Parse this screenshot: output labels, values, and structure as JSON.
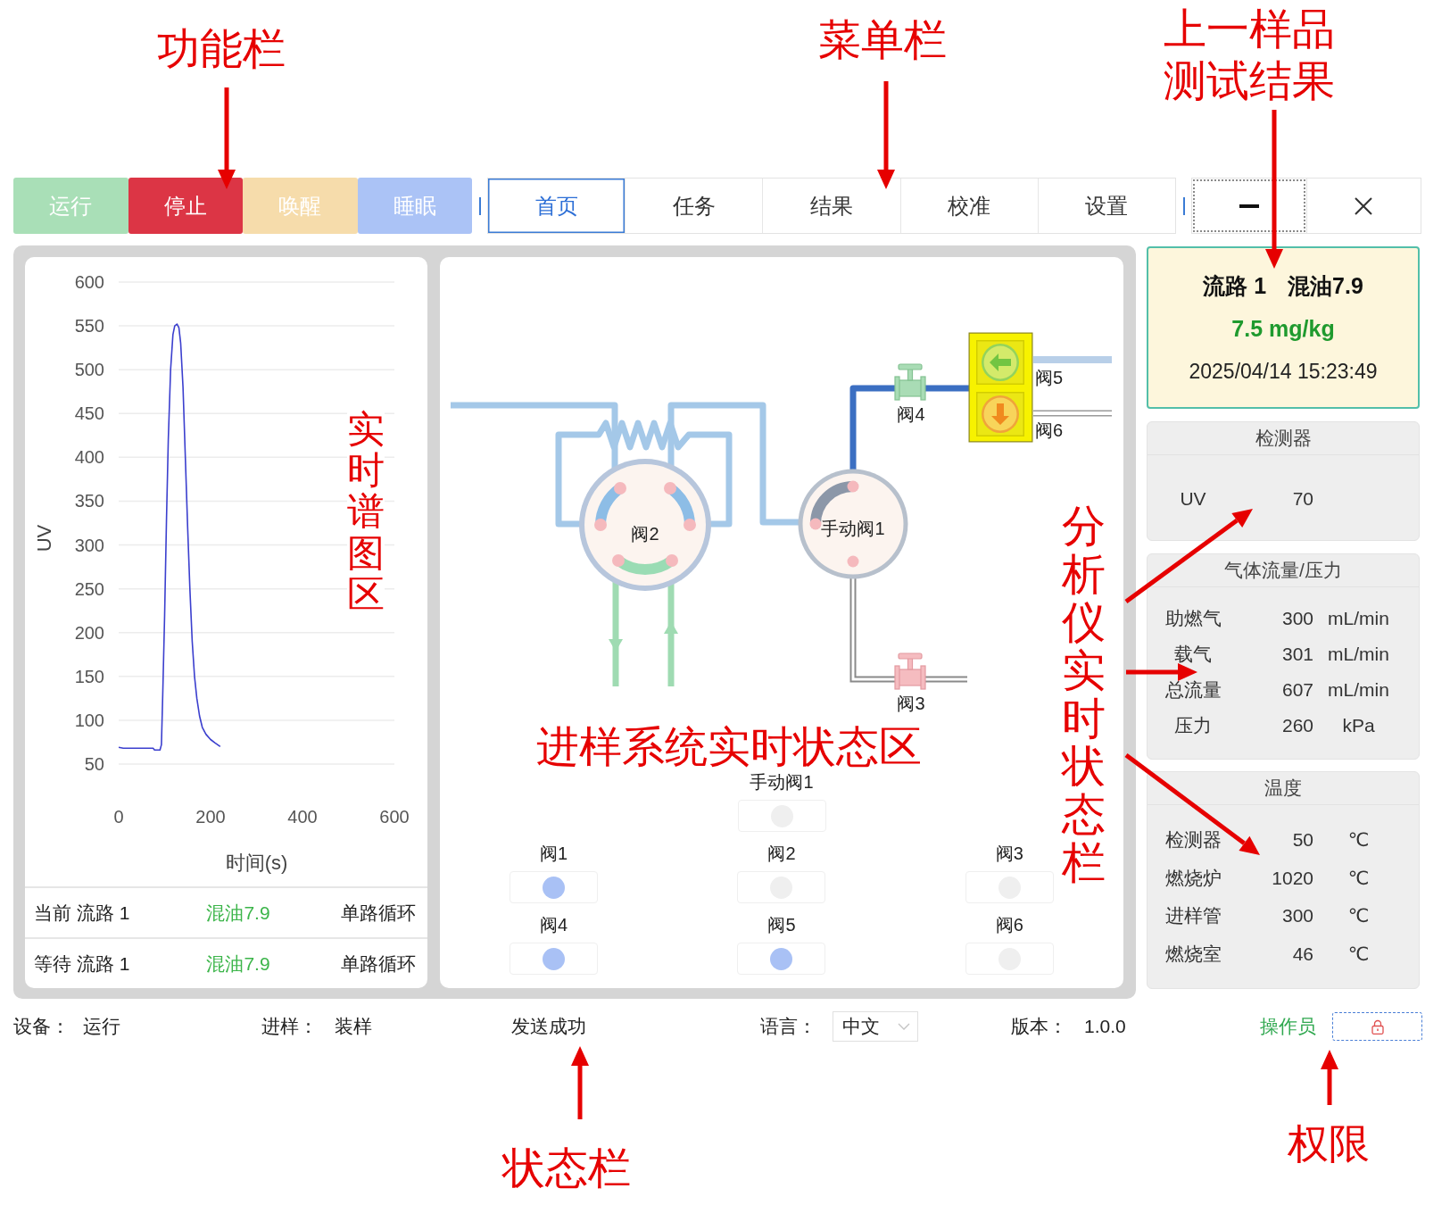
{
  "function_bar": {
    "buttons": [
      {
        "label": "运行",
        "kind": "run",
        "disabled": true
      },
      {
        "label": "停止",
        "kind": "stop",
        "disabled": false
      },
      {
        "label": "唤醒",
        "kind": "wake",
        "disabled": true
      },
      {
        "label": "睡眠",
        "kind": "sleep",
        "disabled": true
      }
    ]
  },
  "menu": {
    "tabs": [
      {
        "label": "首页",
        "selected": true
      },
      {
        "label": "任务",
        "selected": false
      },
      {
        "label": "结果",
        "selected": false
      },
      {
        "label": "校准",
        "selected": false
      },
      {
        "label": "设置",
        "selected": false
      }
    ]
  },
  "window_controls": [
    {
      "kind": "minimize",
      "focused": true
    },
    {
      "kind": "close",
      "focused": false
    }
  ],
  "chart_panel": {
    "chart_data": {
      "type": "line",
      "grid": true,
      "xlabel": "时间(s)",
      "ylabel": "UV",
      "xlim": [
        0,
        600
      ],
      "ylim": [
        50,
        600
      ],
      "xticks": [
        0,
        200,
        400,
        600
      ],
      "yticks": [
        50,
        100,
        150,
        200,
        250,
        300,
        350,
        400,
        450,
        500,
        550,
        600
      ],
      "x": [
        0,
        10,
        40,
        75,
        78,
        90,
        93,
        96,
        100,
        104,
        108,
        113,
        118,
        122,
        127,
        131,
        135,
        140,
        145,
        150,
        155,
        160,
        165,
        170,
        176,
        182,
        190,
        200,
        210,
        221
      ],
      "series": [
        {
          "color": "#3b3fce",
          "values": [
            69,
            68,
            68,
            68,
            66,
            66,
            72,
            130,
            220,
            330,
            420,
            500,
            540,
            550,
            552,
            548,
            530,
            480,
            400,
            320,
            250,
            190,
            150,
            125,
            105,
            92,
            84,
            78,
            74,
            70
          ]
        }
      ]
    },
    "queue": [
      {
        "status": "当前 流路 1",
        "sample": "混油7.9",
        "mode": "单路循环"
      },
      {
        "status": "等待 流路 1",
        "sample": "混油7.9",
        "mode": "单路循环"
      }
    ]
  },
  "diagram": {
    "rotary_valves": [
      {
        "label": "阀2",
        "kind": "multiport"
      },
      {
        "label": "手动阀1",
        "kind": "manual"
      }
    ],
    "inline_valves": [
      {
        "label": "阀4",
        "open": true
      },
      {
        "label": "阀3",
        "open": false
      }
    ],
    "switch_valves": [
      {
        "label": "阀5",
        "open": true
      },
      {
        "label": "阀6",
        "open": false
      }
    ]
  },
  "valve_status": {
    "manual": {
      "label": "手动阀1",
      "on": false
    },
    "valves": [
      {
        "label": "阀1",
        "on": true
      },
      {
        "label": "阀2",
        "on": false
      },
      {
        "label": "阀3",
        "on": false
      },
      {
        "label": "阀4",
        "on": true
      },
      {
        "label": "阀5",
        "on": true
      },
      {
        "label": "阀6",
        "on": false
      }
    ]
  },
  "result_card": {
    "route": "流路 1",
    "sample": "混油7.9",
    "value": "7.5 mg/kg",
    "time": "2025/04/14 15:23:49"
  },
  "detector_panel": {
    "title": "检测器",
    "rows": [
      {
        "label": "UV",
        "value": "70"
      }
    ]
  },
  "gas_panel": {
    "title": "气体流量/压力",
    "rows": [
      {
        "label": "助燃气",
        "value": "300",
        "unit": "mL/min"
      },
      {
        "label": "载气",
        "value": "301",
        "unit": "mL/min"
      },
      {
        "label": "总流量",
        "value": "607",
        "unit": "mL/min"
      },
      {
        "label": "压力",
        "value": "260",
        "unit": "kPa"
      }
    ]
  },
  "temperature_panel": {
    "title": "温度",
    "rows": [
      {
        "label": "检测器",
        "value": "50",
        "unit": "℃"
      },
      {
        "label": "燃烧炉",
        "value": "1020",
        "unit": "℃"
      },
      {
        "label": "进样管",
        "value": "300",
        "unit": "℃"
      },
      {
        "label": "燃烧室",
        "value": "46",
        "unit": "℃"
      }
    ]
  },
  "status_bar": {
    "items": [
      {
        "label": "设备：",
        "value": "运行"
      },
      {
        "label": "进样：",
        "value": "装样"
      }
    ],
    "message": "发送成功",
    "language": {
      "label": "语言：",
      "value": "中文"
    },
    "version": {
      "label": "版本：",
      "value": "1.0.0"
    },
    "user_role": "操作员"
  },
  "annotations": [
    {
      "text": "功能栏",
      "kind": "horizontal"
    },
    {
      "text": "菜单栏",
      "kind": "horizontal"
    },
    {
      "text": "上一样品测试结果",
      "kind": "horizontal"
    },
    {
      "text": "实时谱图区",
      "kind": "vertical"
    },
    {
      "text": "进样系统实时状态区",
      "kind": "horizontal"
    },
    {
      "text": "分析仪实时状态栏",
      "kind": "vertical"
    },
    {
      "text": "状态栏",
      "kind": "horizontal"
    },
    {
      "text": "权限",
      "kind": "horizontal"
    }
  ]
}
